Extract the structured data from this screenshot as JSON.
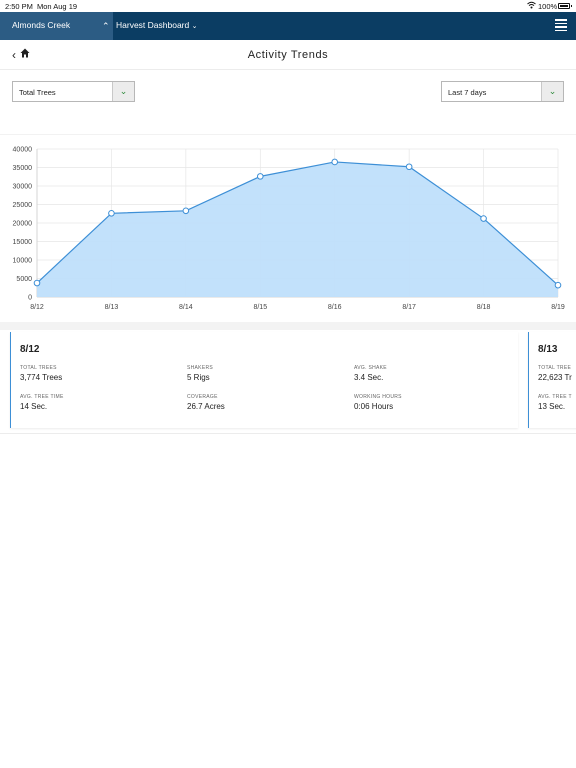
{
  "status_bar": {
    "time": "2:50 PM",
    "date": "Mon Aug 19",
    "battery": "100%"
  },
  "nav": {
    "farm": "Almonds Creek",
    "dashboard": "Harvest Dashboard"
  },
  "header": {
    "title": "Activity Trends"
  },
  "filters": {
    "metric": "Total Trees",
    "range": "Last 7 days"
  },
  "chart_data": {
    "type": "area",
    "x": [
      "8/12",
      "8/13",
      "8/14",
      "8/15",
      "8/16",
      "8/17",
      "8/18",
      "8/19"
    ],
    "series": [
      {
        "values": [
          3774,
          22623,
          23300,
          32600,
          36500,
          35200,
          21200,
          3200
        ]
      }
    ],
    "y_ticks": [
      "0",
      "5000",
      "10000",
      "15000",
      "20000",
      "25000",
      "30000",
      "35000",
      "40000"
    ],
    "ylim": [
      0,
      40000
    ],
    "grid": true,
    "colors": {
      "line": "#3d8fd6",
      "fill": "#bfdffb"
    }
  },
  "cards": [
    {
      "date": "8/12",
      "stats": [
        {
          "label": "Total Trees",
          "value": "3,774 Trees"
        },
        {
          "label": "Shakers",
          "value": "5 Rigs"
        },
        {
          "label": "Avg. Shake",
          "value": "3.4 Sec."
        },
        {
          "label": "Avg. Tree Time",
          "value": "14 Sec."
        },
        {
          "label": "Coverage",
          "value": "26.7 Acres"
        },
        {
          "label": "Working Hours",
          "value": "0:06 Hours"
        }
      ]
    },
    {
      "date": "8/13",
      "stats": [
        {
          "label": "Total Tree",
          "value": "22,623 Tr"
        },
        {
          "label": "Avg. Tree T",
          "value": "13 Sec."
        }
      ]
    }
  ]
}
